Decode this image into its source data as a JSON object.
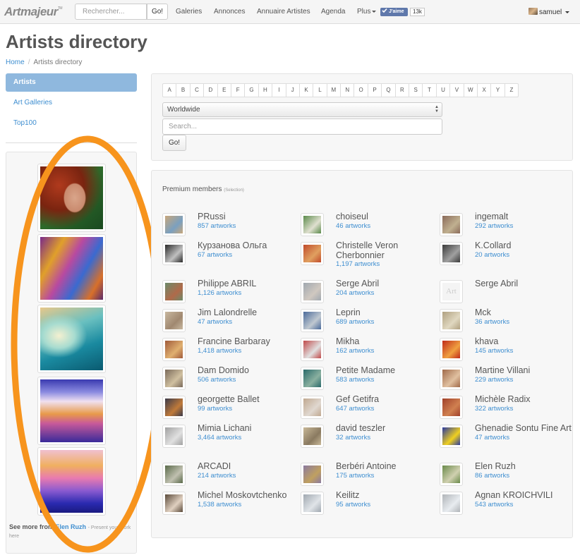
{
  "navbar": {
    "logo": "Artmajeur",
    "logo_mark": "TM",
    "search_placeholder": "Rechercher...",
    "search_button": "Go!",
    "links": [
      "Galeries",
      "Annonces",
      "Annuaire Artistes",
      "Agenda",
      "Plus"
    ],
    "like_label": "J'aime",
    "like_count": "13k",
    "username": "samuel"
  },
  "page": {
    "title": "Artists directory",
    "breadcrumb": [
      "Home",
      "Artists directory"
    ]
  },
  "sidebar": {
    "items": [
      {
        "label": "Artists",
        "active": true
      },
      {
        "label": "Art Galleries",
        "active": false
      },
      {
        "label": "Top100",
        "active": false
      }
    ],
    "showcase": {
      "thumbnails": [
        {
          "alt": "portrait-painting"
        },
        {
          "alt": "abstract-painting"
        },
        {
          "alt": "sea-wave-painting"
        },
        {
          "alt": "sunset-landscape-painting"
        },
        {
          "alt": "purple-hills-painting"
        }
      ],
      "see_more_prefix": "See more from",
      "artist": "Elen Ruzh",
      "suffix": "- Present your work here"
    },
    "highlight_color": "#f7941d"
  },
  "filter": {
    "letters": [
      "A",
      "B",
      "C",
      "D",
      "E",
      "F",
      "G",
      "H",
      "I",
      "J",
      "K",
      "L",
      "M",
      "N",
      "O",
      "P",
      "Q",
      "R",
      "S",
      "T",
      "U",
      "V",
      "W",
      "X",
      "Y",
      "Z"
    ],
    "region": "Worldwide",
    "search_placeholder": "Search...",
    "go_label": "Go!"
  },
  "premium": {
    "title": "Premium members",
    "selection": "(Selection)",
    "members": [
      {
        "name": "PRussi",
        "artworks": "857 artworks"
      },
      {
        "name": "choiseul",
        "artworks": "46 artworks"
      },
      {
        "name": "ingemalt",
        "artworks": "292 artworks"
      },
      {
        "name": "Курзанова Ольга",
        "artworks": "67 artworks"
      },
      {
        "name": "Christelle Veron Cherbonnier",
        "artworks": "1,197 artworks"
      },
      {
        "name": "K.Collard",
        "artworks": "20 artworks"
      },
      {
        "name": "Philippe ABRIL",
        "artworks": "1,126 artworks"
      },
      {
        "name": "Serge Abril",
        "artworks": "204 artworks"
      },
      {
        "name": "Serge Abril",
        "artworks": ""
      },
      {
        "name": "Jim Lalondrelle",
        "artworks": "47 artworks"
      },
      {
        "name": "Leprin",
        "artworks": "689 artworks"
      },
      {
        "name": "Mck",
        "artworks": "36 artworks"
      },
      {
        "name": "Francine Barbaray",
        "artworks": "1,418 artworks"
      },
      {
        "name": "Mikha",
        "artworks": "162 artworks"
      },
      {
        "name": "khava",
        "artworks": "145 artworks"
      },
      {
        "name": "Dam Domido",
        "artworks": "506 artworks"
      },
      {
        "name": "Petite Madame",
        "artworks": "583 artworks"
      },
      {
        "name": "Martine Villani",
        "artworks": "229 artworks"
      },
      {
        "name": "georgette Ballet",
        "artworks": "99 artworks"
      },
      {
        "name": "Gef Getifra",
        "artworks": "647 artworks"
      },
      {
        "name": "Michèle Radix",
        "artworks": "322 artworks"
      },
      {
        "name": "Mimia Lichani",
        "artworks": "3,464 artworks"
      },
      {
        "name": "david teszler",
        "artworks": "32 artworks"
      },
      {
        "name": "Ghenadie Sontu Fine Art",
        "artworks": "47 artworks"
      },
      {
        "name": "ARCADI",
        "artworks": "214 artworks"
      },
      {
        "name": "Berbéri Antoine",
        "artworks": "175 artworks"
      },
      {
        "name": "Elen Ruzh",
        "artworks": "86 artworks"
      },
      {
        "name": "Michel Moskovtchenko",
        "artworks": "1,538 artworks"
      },
      {
        "name": "Keilitz",
        "artworks": "95 artworks"
      },
      {
        "name": "Agnan KROICHVILI",
        "artworks": "543 artworks"
      }
    ],
    "placeholder_avatar_text": "Art"
  }
}
